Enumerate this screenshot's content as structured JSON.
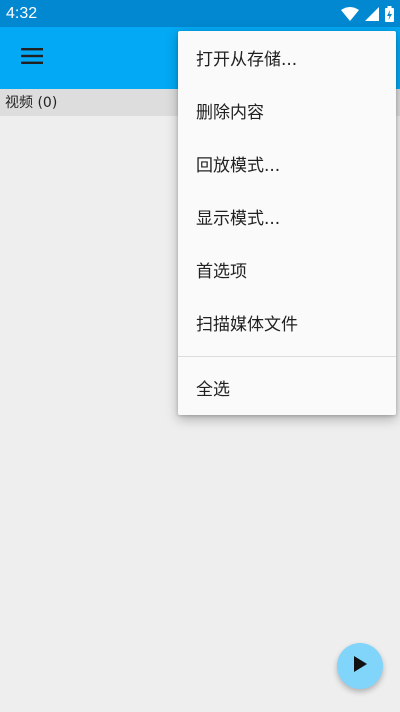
{
  "status_bar": {
    "time": "4:32",
    "icons": [
      "wifi-icon",
      "cell-signal-icon",
      "battery-charging-icon"
    ]
  },
  "app_bar": {
    "menu_icon": "hamburger-menu-icon",
    "background": "#03a9f4"
  },
  "section": {
    "label": "视频 (0)"
  },
  "overflow_menu": {
    "items": [
      "打开从存储...",
      "删除内容",
      "回放模式...",
      "显示模式...",
      "首选项",
      "扫描媒体文件",
      "全选"
    ]
  },
  "fab": {
    "icon": "play-icon",
    "color": "#81d4fa"
  },
  "colors": {
    "status_bar": "#0288d1",
    "app_bar": "#03a9f4",
    "section_header": "#dddddd",
    "background": "#eeeeee",
    "menu_background": "#fafafa"
  }
}
